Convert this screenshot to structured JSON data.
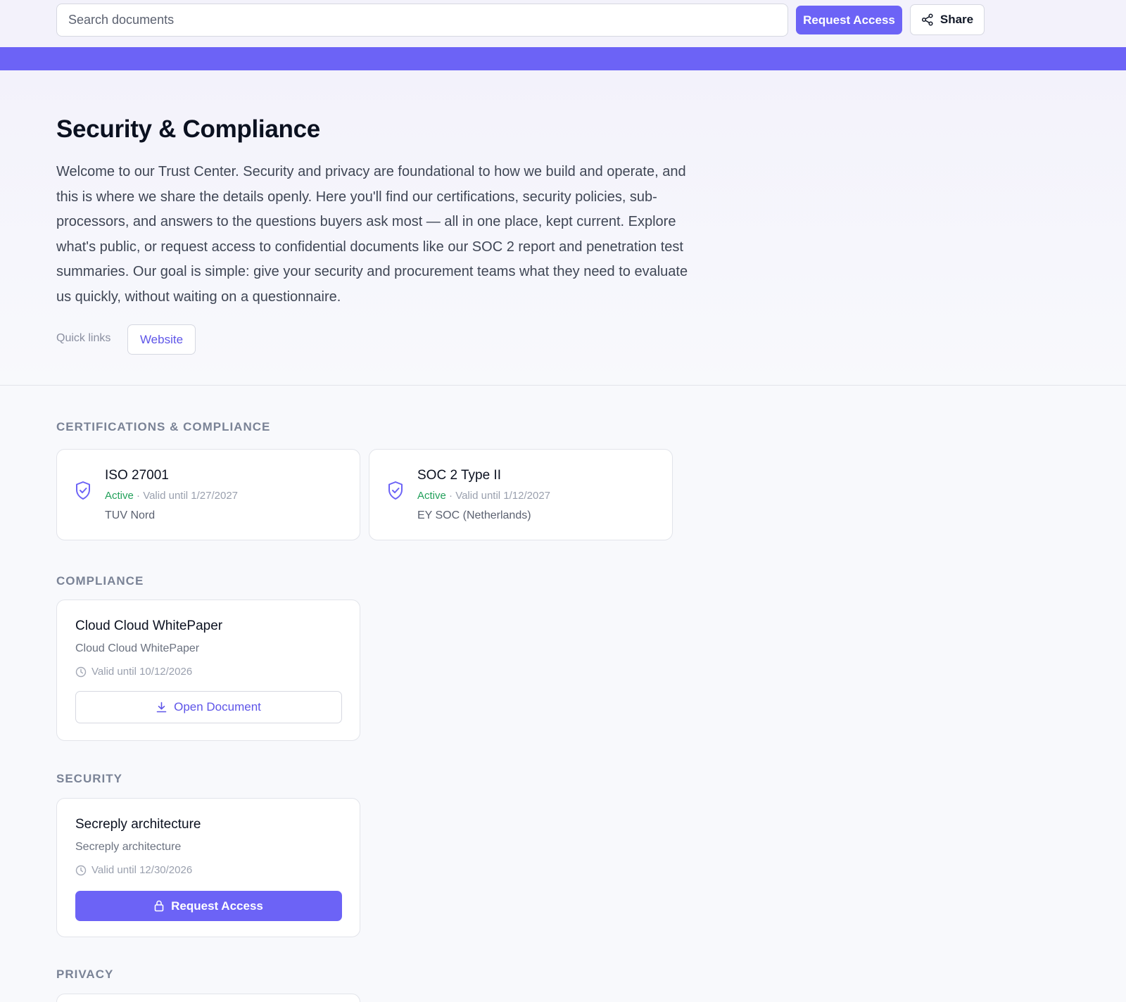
{
  "header": {
    "search_placeholder": "Search documents",
    "request_access_label": "Request Access",
    "share_label": "Share"
  },
  "hero": {
    "title": "Security & Compliance",
    "intro": "Welcome to our Trust Center. Security and privacy are foundational to how we build and operate, and this is where we share the details openly. Here you'll find our certifications, security policies, sub-processors, and answers to the questions buyers ask most — all in one place, kept current. Explore what's public, or request access to confidential documents like our SOC 2 report and penetration test summaries. Our goal is simple: give your security and procurement teams what they need to evaluate us quickly, without waiting on a questionnaire.",
    "quick_links_label": "Quick links",
    "quick_links": [
      "Website"
    ]
  },
  "sections": {
    "certifications": {
      "title": "CERTIFICATIONS & COMPLIANCE",
      "items": [
        {
          "name": "ISO 27001",
          "status": "Active",
          "valid": "· Valid until 1/27/2027",
          "issuer": "TUV Nord"
        },
        {
          "name": "SOC 2 Type II",
          "status": "Active",
          "valid": "· Valid until 1/12/2027",
          "issuer": "EY SOC (Netherlands)"
        }
      ]
    },
    "compliance": {
      "title": "COMPLIANCE",
      "doc": {
        "title": "Cloud Cloud WhitePaper",
        "subtitle": "Cloud Cloud WhitePaper",
        "valid": "Valid until 10/12/2026",
        "action": "Open Document"
      }
    },
    "security": {
      "title": "SECURITY",
      "doc": {
        "title": "Secreply architecture",
        "subtitle": "Secreply architecture",
        "valid": "Valid until 12/30/2026",
        "action": "Request Access"
      }
    },
    "privacy": {
      "title": "PRIVACY"
    }
  },
  "colors": {
    "accent": "#6c63f6",
    "status_active": "#22a05a",
    "section_label": "#7a8396"
  },
  "icons": [
    "share-icon",
    "shield-check-icon",
    "clock-icon",
    "download-icon",
    "lock-icon"
  ]
}
